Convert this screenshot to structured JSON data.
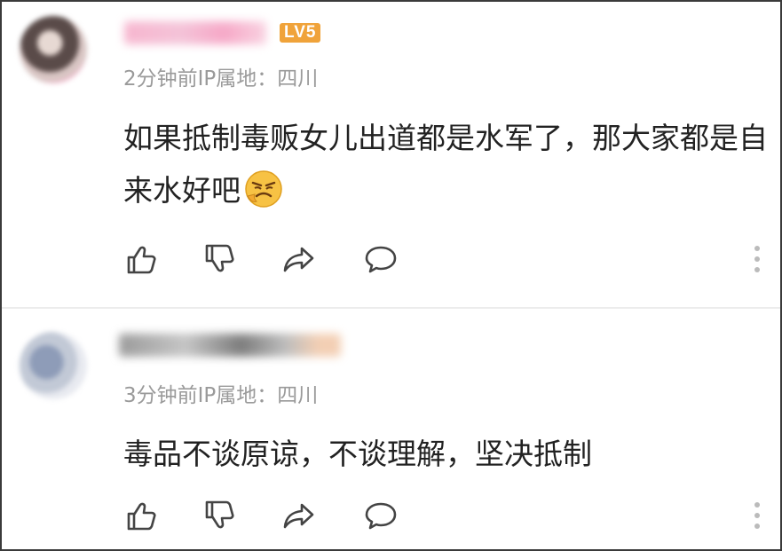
{
  "comments": [
    {
      "level_badge": "LV5",
      "meta": "2分钟前IP属地：四川",
      "text": "如果抵制毒贩女儿出道都是水军了，那大家都是自来水好吧",
      "emoji": "angry-face-emoji"
    },
    {
      "meta": "3分钟前IP属地：四川",
      "text": "毒品不谈原谅，不谈理解，坚决抵制"
    }
  ],
  "colors": {
    "level_badge": "#f0a33a",
    "meta_text": "#9a9a9a",
    "body_text": "#222222",
    "icon": "#444444"
  },
  "icons": [
    "thumbs-up-icon",
    "thumbs-down-icon",
    "share-icon",
    "reply-icon",
    "more-icon"
  ]
}
